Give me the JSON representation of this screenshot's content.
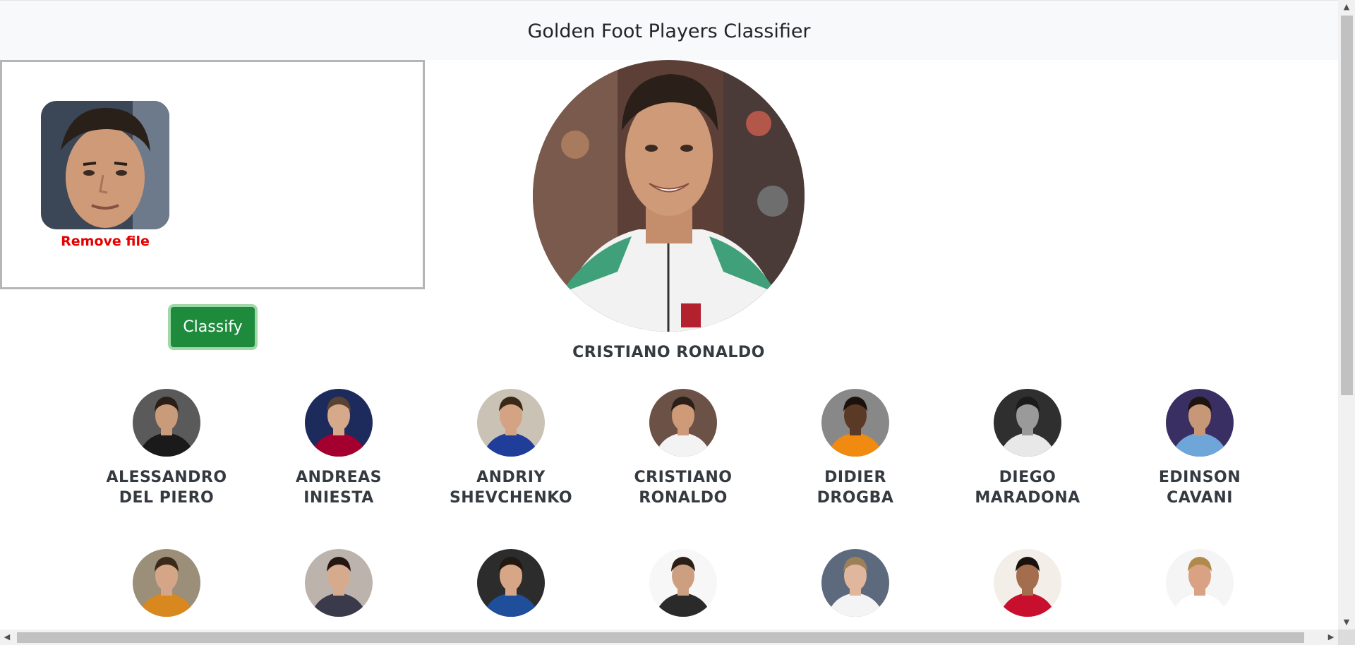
{
  "navbar": {
    "title": "Golden Foot Players Classifier"
  },
  "upload": {
    "remove_label": "Remove file"
  },
  "actions": {
    "classify_label": "Classify"
  },
  "result": {
    "name": "CRISTIANO RONALDO"
  },
  "players": [
    {
      "name": "ALESSANDRO DEL PIERO",
      "bg": "#5a5a5a",
      "shirt": "#1a1a1a",
      "skin": "#c99b7a",
      "hair": "#2b1e16"
    },
    {
      "name": "ANDREAS INIESTA",
      "bg": "#1d2a5c",
      "shirt": "#a3002f",
      "skin": "#d7a98b",
      "hair": "#5a4332"
    },
    {
      "name": "ANDRIY SHEVCHENKO",
      "bg": "#c9c2b5",
      "shirt": "#1f3d99",
      "skin": "#d3a383",
      "hair": "#3a2819"
    },
    {
      "name": "CRISTIANO RONALDO",
      "bg": "#6b5146",
      "shirt": "#f3f3f3",
      "skin": "#cf9a78",
      "hair": "#2a1f19"
    },
    {
      "name": "DIDIER DROGBA",
      "bg": "#888888",
      "shirt": "#f08a10",
      "skin": "#5a3a26",
      "hair": "#1b120d"
    },
    {
      "name": "DIEGO MARADONA",
      "bg": "#2f2f2f",
      "shirt": "#e8e8e8",
      "skin": "#9a9a9a",
      "hair": "#1b1b1b"
    },
    {
      "name": "EDINSON CAVANI",
      "bg": "#3a2f63",
      "shirt": "#6fa6d9",
      "skin": "#c79877",
      "hair": "#1e1510"
    },
    {
      "name": "",
      "bg": "#9b8f7a",
      "shirt": "#d8881e",
      "skin": "#d4a687",
      "hair": "#3a2a1a"
    },
    {
      "name": "",
      "bg": "#bdb3ad",
      "shirt": "#3a3a4a",
      "skin": "#d5aa8d",
      "hair": "#241712"
    },
    {
      "name": "",
      "bg": "#2c2c2c",
      "shirt": "#1f4f9a",
      "skin": "#d6a686",
      "hair": "#231810"
    },
    {
      "name": "",
      "bg": "#f7f7f7",
      "shirt": "#2a2a2a",
      "skin": "#cc9f80",
      "hair": "#2b1f18"
    },
    {
      "name": "",
      "bg": "#5d6a7d",
      "shirt": "#f4f4f4",
      "skin": "#e0b79c",
      "hair": "#9c8057"
    },
    {
      "name": "",
      "bg": "#f3efe8",
      "shirt": "#c8102e",
      "skin": "#a46d4e",
      "hair": "#1a120c"
    },
    {
      "name": "",
      "bg": "#f5f5f5",
      "shirt": "#ffffff",
      "skin": "#d8a283",
      "hair": "#b08a4a"
    }
  ],
  "icons": {
    "scroll_up": "▲",
    "scroll_down": "▼",
    "scroll_left": "◀",
    "scroll_right": "▶"
  }
}
